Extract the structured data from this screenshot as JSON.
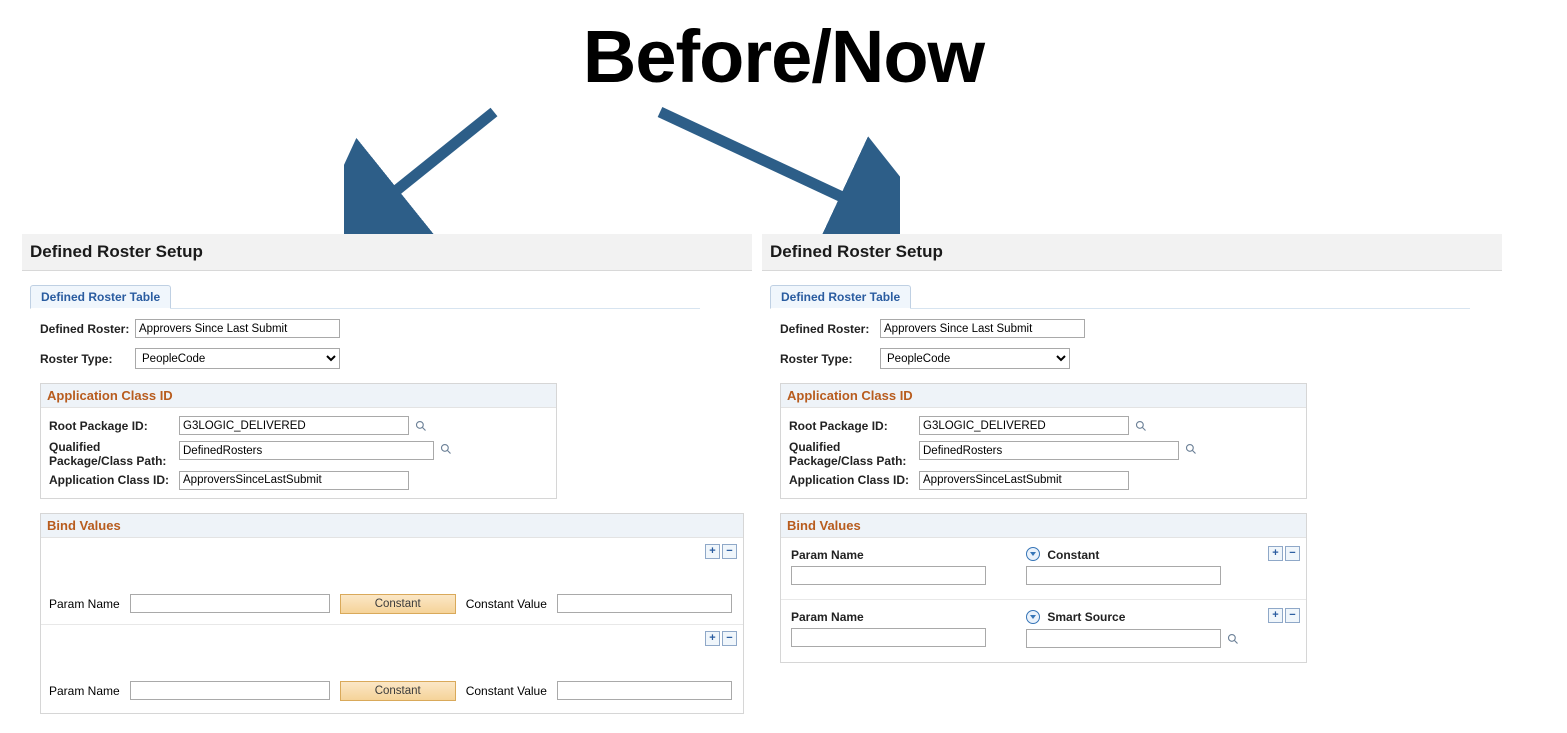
{
  "title": "Before/Now",
  "left": {
    "page_title": "Defined Roster Setup",
    "tab_label": "Defined Roster Table",
    "fields": {
      "defined_roster_label": "Defined Roster:",
      "defined_roster_value": "Approvers Since Last Submit",
      "roster_type_label": "Roster Type:",
      "roster_type_value": "PeopleCode"
    },
    "app_class": {
      "header": "Application Class ID",
      "root_package_label": "Root Package ID:",
      "root_package_value": "G3LOGIC_DELIVERED",
      "qual_path_label": "Qualified Package/Class Path:",
      "qual_path_value": "DefinedRosters",
      "app_class_label": "Application Class ID:",
      "app_class_value": "ApproversSinceLastSubmit"
    },
    "bind": {
      "header": "Bind Values",
      "param_name_label": "Param Name",
      "constant_button": "Constant",
      "constant_value_label": "Constant Value"
    }
  },
  "right": {
    "page_title": "Defined Roster Setup",
    "tab_label": "Defined Roster Table",
    "fields": {
      "defined_roster_label": "Defined Roster:",
      "defined_roster_value": "Approvers Since Last Submit",
      "roster_type_label": "Roster Type:",
      "roster_type_value": "PeopleCode"
    },
    "app_class": {
      "header": "Application Class ID",
      "root_package_label": "Root Package ID:",
      "root_package_value": "G3LOGIC_DELIVERED",
      "qual_path_label": "Qualified Package/Class Path:",
      "qual_path_value": "DefinedRosters",
      "app_class_label": "Application Class ID:",
      "app_class_value": "ApproversSinceLastSubmit"
    },
    "bind": {
      "header": "Bind Values",
      "param_name_label": "Param Name",
      "constant_label": "Constant",
      "smart_source_label": "Smart Source"
    }
  }
}
